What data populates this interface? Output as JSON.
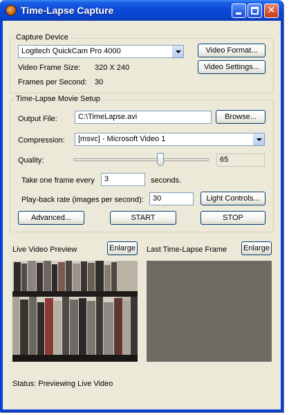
{
  "window": {
    "title": "Time-Lapse Capture",
    "title_buttons": {
      "minimize": "minimize",
      "maximize": "maximize",
      "close": "✕"
    }
  },
  "capture_device": {
    "group_label": "Capture Device",
    "device_selected": "Logitech QuickCam Pro 4000",
    "video_format_button": "Video Format...",
    "video_settings_button": "Video Settings...",
    "frame_size_label": "Video Frame Size:",
    "frame_size_value": "320 X 240",
    "fps_label": "Frames per Second:",
    "fps_value": "30"
  },
  "movie_setup": {
    "group_label": "Time-Lapse Movie Setup",
    "output_file_label": "Output File:",
    "output_file_value": "C:\\TimeLapse.avi",
    "browse_button": "Browse...",
    "compression_label": "Compression:",
    "compression_selected": "[msvc] - Microsoft Video 1",
    "quality_label": "Quality:",
    "quality_value": "65",
    "quality_fraction": 0.65,
    "take_frame_label": "Take one frame every",
    "take_frame_value": "3",
    "seconds_label": "seconds.",
    "playback_label": "Play-back rate (images per second):",
    "playback_value": "30",
    "light_controls_button": "Light Controls...",
    "advanced_button": "Advanced...",
    "start_button": "START",
    "stop_button": "STOP"
  },
  "previews": {
    "live_label": "Live Video Preview",
    "live_enlarge": "Enlarge",
    "last_label": "Last Time-Lapse Frame",
    "last_enlarge": "Enlarge"
  },
  "status": {
    "text": "Status: Previewing Live Video"
  },
  "colors": {
    "titlebar": "#0b48d6",
    "dialog_bg": "#ece9d8",
    "last_frame_bg": "#6f6a63"
  }
}
